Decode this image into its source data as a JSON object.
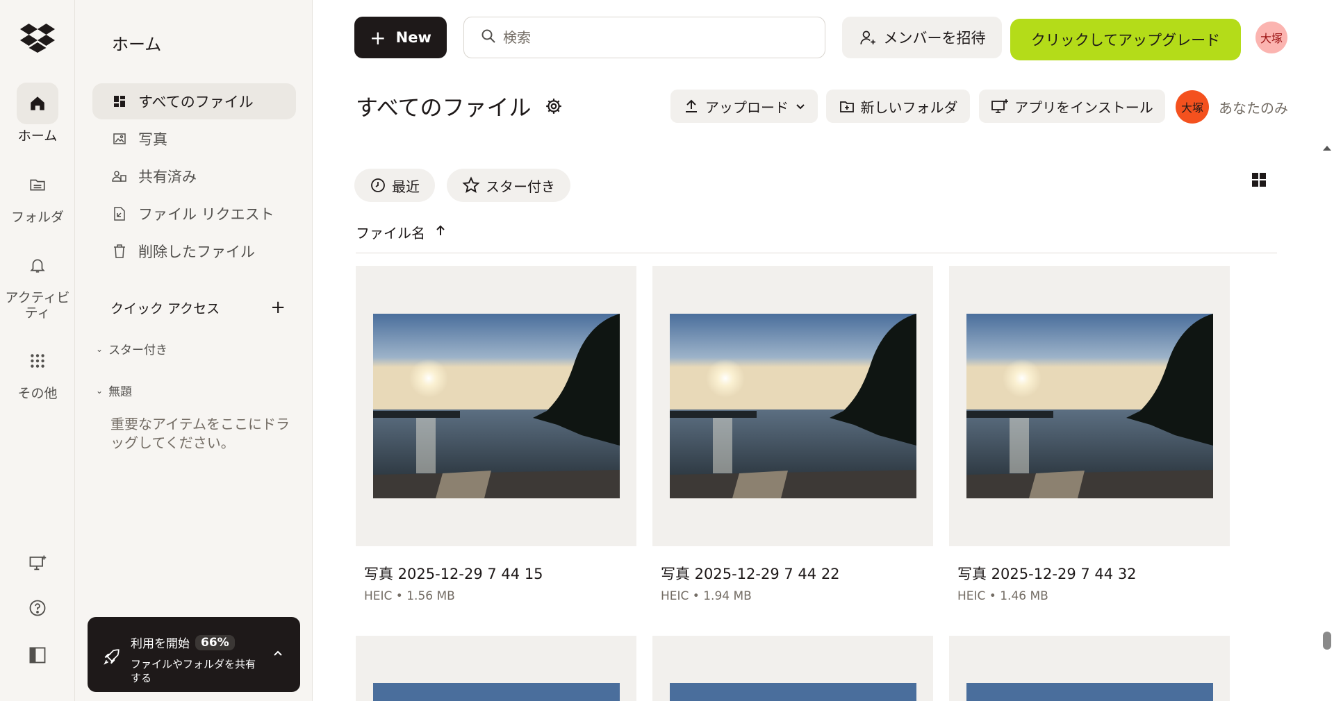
{
  "rail": {
    "items": [
      {
        "label": "ホーム",
        "icon": "home-icon"
      },
      {
        "label": "フォルダ",
        "icon": "folder-icon"
      },
      {
        "label": "アクティビティ",
        "icon": "bell-icon"
      },
      {
        "label": "その他",
        "icon": "apps-grid-icon"
      }
    ],
    "bottom_icons": [
      "desktop-app-icon",
      "help-icon",
      "panel-toggle-icon"
    ]
  },
  "sidebar": {
    "title": "ホーム",
    "items": [
      {
        "label": "すべてのファイル",
        "icon": "all-files-icon"
      },
      {
        "label": "写真",
        "icon": "photo-icon"
      },
      {
        "label": "共有済み",
        "icon": "shared-icon"
      },
      {
        "label": "ファイル リクエスト",
        "icon": "file-request-icon"
      },
      {
        "label": "削除したファイル",
        "icon": "trash-icon"
      }
    ],
    "quick_access": {
      "label": "クイック アクセス",
      "starred": "スター付き",
      "untitled": "無題",
      "hint": "重要なアイテムをここにドラッグしてください。"
    },
    "promo": {
      "title": "利用を開始",
      "percent": "66%",
      "text": "ファイルやフォルダを共有する"
    }
  },
  "topbar": {
    "new_label": "New",
    "search_placeholder": "検索",
    "invite_label": "メンバーを招待",
    "upgrade_label": "クリックしてアップグレード",
    "avatar_initials": "大塚"
  },
  "page": {
    "title": "すべてのファイル",
    "upload_label": "アップロード",
    "new_folder_label": "新しいフォルダ",
    "install_app_label": "アプリをインストール",
    "owner_initials": "大塚",
    "visibility": "あなたのみ",
    "chips": {
      "recent": "最近",
      "starred": "スター付き"
    },
    "column_header": "ファイル名"
  },
  "files": [
    {
      "name": "写真 2025-12-29 7 44 15",
      "meta": "HEIC • 1.56 MB"
    },
    {
      "name": "写真 2025-12-29 7 44 22",
      "meta": "HEIC • 1.94 MB"
    },
    {
      "name": "写真 2025-12-29 7 44 32",
      "meta": "HEIC • 1.46 MB"
    }
  ],
  "colors": {
    "accent_upgrade": "#b4dc19",
    "avatar_owner": "#f4511e",
    "avatar_top": "#fbb4b0",
    "dark": "#1e1919"
  }
}
